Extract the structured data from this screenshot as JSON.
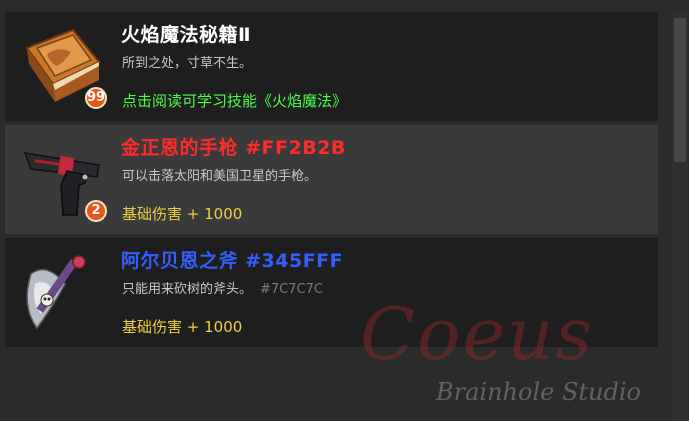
{
  "items": [
    {
      "title": "火焰魔法秘籍Ⅱ",
      "title_color": "#ffffff",
      "description": "所到之处，寸草不生。",
      "description_tag": "",
      "count": "99",
      "footer": "点击阅读可学习技能《火焰魔法》",
      "footer_color": "#4cff4c",
      "icon": "spellbook-icon",
      "selected": false
    },
    {
      "title": "金正恩的手枪 #FF2B2B",
      "title_color": "#ff2b2b",
      "description": "可以击落太阳和美国卫星的手枪。",
      "description_tag": "",
      "count": "2",
      "footer": "基础伤害 + 1000",
      "footer_color": "#f0d040",
      "icon": "pistol-icon",
      "selected": true
    },
    {
      "title": "阿尔贝恩之斧 #345FFF",
      "title_color": "#345fff",
      "description": "只能用来砍树的斧头。",
      "description_tag": "#7C7C7C",
      "count": "",
      "footer": "基础伤害 + 1000",
      "footer_color": "#f0d040",
      "icon": "axe-icon",
      "selected": false
    }
  ],
  "watermark": {
    "logo": "Coeus",
    "subtitle": "Brainhole Studio"
  }
}
